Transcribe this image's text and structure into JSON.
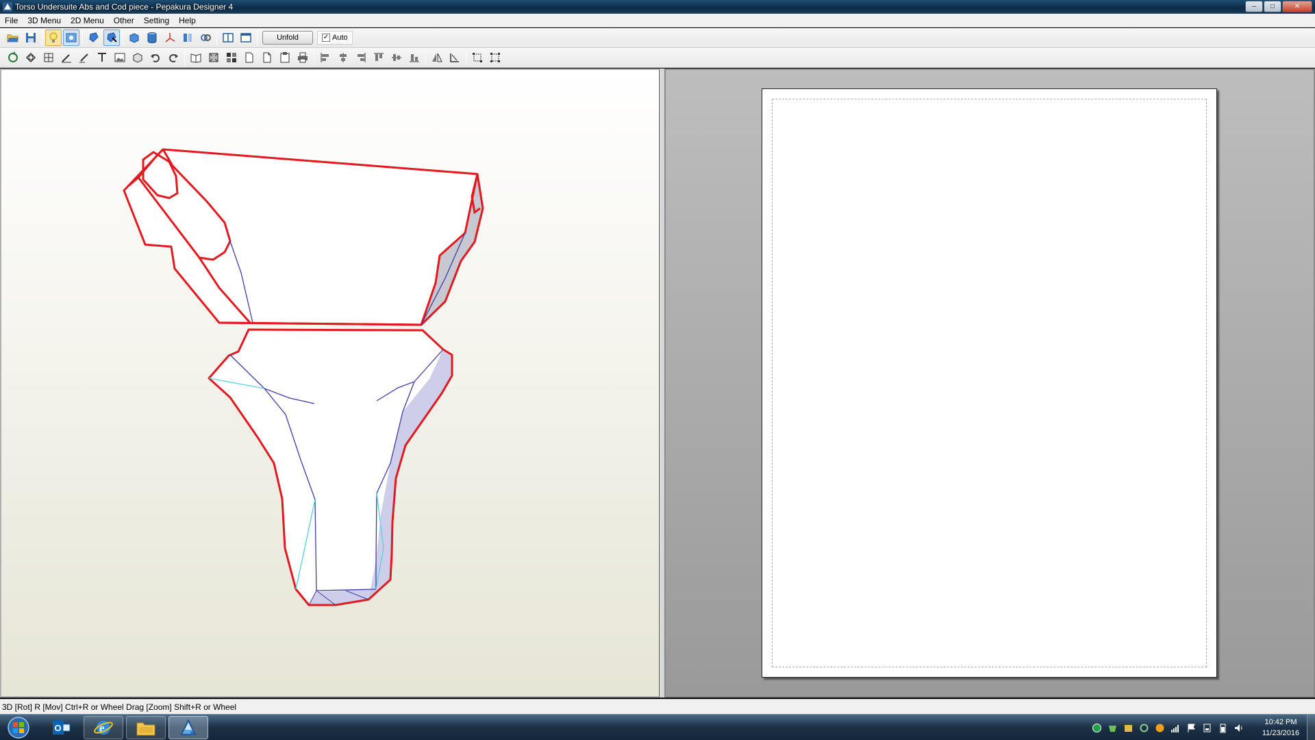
{
  "window": {
    "title": "Torso Undersuite Abs and Cod piece - Pepakura Designer 4",
    "controls": [
      "–",
      "□",
      "✕"
    ]
  },
  "menu": [
    "File",
    "3D Menu",
    "2D Menu",
    "Other",
    "Setting",
    "Help"
  ],
  "toolbar1": {
    "icons": [
      "open-icon",
      "save-icon",
      "bulb-icon",
      "texture-icon",
      "rotate-model-icon",
      "select-model-icon",
      "cube-icon",
      "cylinder-icon",
      "axis-icon",
      "columns-icon",
      "link-icon",
      "split-view-icon",
      "single-view-icon"
    ],
    "unfold_label": "Unfold",
    "auto_label": "Auto",
    "auto_checked": "✓"
  },
  "toolbar2": {
    "icons": [
      "rotate-tool-icon",
      "shape-tool-icon",
      "join-tool-icon",
      "pencil-icon",
      "edge-icon",
      "text-icon",
      "image-icon",
      "box-icon",
      "undo-icon",
      "redo-icon",
      "book-icon",
      "fit-icon",
      "grid-icon",
      "page-icon",
      "page-fold-icon",
      "clipboard-icon",
      "print-icon",
      "align-left-icon",
      "align-center-icon",
      "align-right-icon",
      "align-top-icon",
      "align-middle-icon",
      "align-bottom-icon",
      "mirror-icon",
      "flip-icon",
      "resize-icon",
      "resize-all-icon"
    ]
  },
  "status": {
    "text": "3D [Rot] R [Mov] Ctrl+R or Wheel Drag [Zoom] Shift+R or Wheel"
  },
  "taskbar": {
    "apps": [
      "outlook-icon",
      "internet-explorer-icon",
      "file-explorer-icon",
      "pepakura-icon"
    ],
    "clock_time": "10:42 PM",
    "clock_date": "11/23/2016"
  },
  "colors": {
    "cut_line": "#e3191f",
    "fold_line": "#3c3ca8",
    "valley_line": "#4fd3de",
    "shade": "#c6c6e6"
  }
}
